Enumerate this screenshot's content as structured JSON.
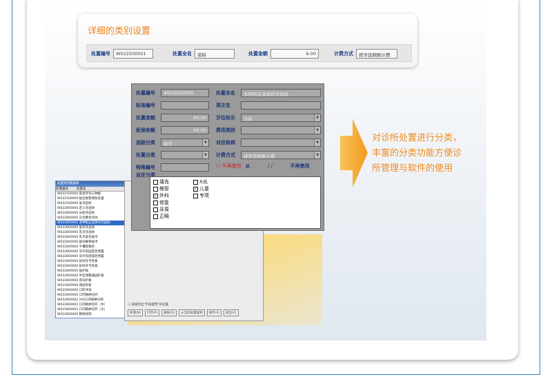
{
  "settings": {
    "title": "详细的类别设置",
    "fields": [
      {
        "label": "处置编号",
        "value": "W022500001"
      },
      {
        "label": "处置全名",
        "value": "资料"
      },
      {
        "label": "处置金额",
        "value": "6.00"
      },
      {
        "label": "计费方式",
        "value": "按牙齿颗数计费"
      }
    ]
  },
  "callout": {
    "lines": [
      "对诊所处置进行分类，",
      "丰富的分类功能方便诊",
      "所管理与软件的使用"
    ]
  },
  "dialog": {
    "code_label": "处置编号",
    "code_value": "W022800005",
    "fullname_label": "处置全名",
    "fullname_value": "多种陪支选择伏牙齿除",
    "std_label": "标准编号",
    "std_value": "",
    "english_label": "英文名",
    "english_value": "",
    "amount_label": "处置金额",
    "amount_value": "60.00",
    "dept_label": "牙位标示",
    "dept_value": "外科",
    "insurance_label": "医保金额",
    "insurance_value": "60.00",
    "fee_type_label": "费用类别",
    "fee_type_value": "",
    "track_label": "追踪分类",
    "track_value": "拔牙",
    "disease_label": "对应疾病",
    "disease_value": "",
    "cat_label": "处置分类",
    "cat_value": "",
    "billing_label": "计费方式",
    "billing_value": "按牙齿颗数计费",
    "special_label": "特殊编号",
    "special_value": "",
    "unused_label": "不再使用",
    "from_label": "从",
    "date_value": "/   /",
    "stop_label": "不再使用",
    "custom_label": "自定分类",
    "checks": [
      {
        "label": "填充",
        "checked": false
      },
      {
        "label": "根管",
        "checked": false
      },
      {
        "label": "外科",
        "checked": true
      },
      {
        "label": "修复",
        "checked": false
      },
      {
        "label": "牙周",
        "checked": false
      },
      {
        "label": "正畸",
        "checked": false
      },
      {
        "label": "X光",
        "checked": false
      },
      {
        "label": "儿童",
        "checked": true
      },
      {
        "label": "专项",
        "checked": false
      }
    ]
  },
  "list_window": {
    "title": "处置资料数据库",
    "headers": [
      "处置编号",
      "处置名"
    ],
    "rows": [
      "W022500000 套具手导入种植",
      "W022500009 拔出根管预防处置",
      "W022500000 复牙齿除",
      "W022800000 定义牙齿除",
      "W022800000 长嵌牙齿除",
      "W022800000 正位整合牙除",
      "W022800005 多种陪支选择伏牙齿除",
      "W022800000 复杂牙齿除",
      "W022800000 乳牙牙齿除",
      "W022800000 乳牙复位拔牙",
      "W022800000 拔牙脚骨拔术",
      "W022800000 干槽症换药",
      "W022800000 牙外伤固定后预置",
      "W022800000 牙外伤结碎后预置",
      "W022800000 拆除牙弓夹板",
      "W022800000 拆除牙弓夹板",
      "W022800000 固护板",
      "W022800000 中空调整器固护板",
      "W022800000 骨牙护板",
      "W022800000 保固导板",
      "W022800000 口腔冲洗",
      "W022800000 口内脓肿切开",
      "W022800002 200口内脓肿切开",
      "W022800002 口内脓肿切开（中）",
      "W022800002 口内脓肿切开（大）",
      "W022800000 脓肿穿刺"
    ]
  },
  "back_dialog": {
    "check_text": "表格列出\"不再使用\"的处置",
    "buttons": [
      "新增(N)",
      "打印(P)",
      "删除(D)",
      "从当前处置复制",
      "保存(S)",
      "退出(X)"
    ]
  },
  "colors": {
    "accent": "#e8841c",
    "frame": "#2c7fb8",
    "label_blue": "#1c3378"
  }
}
